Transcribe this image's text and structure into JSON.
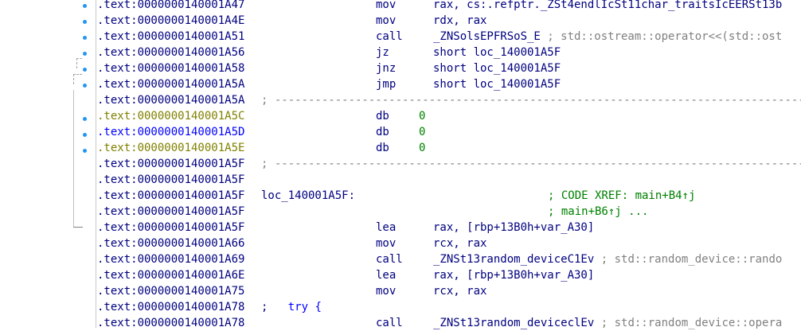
{
  "rows": [
    {
      "addr": ".text:0000000140001A47",
      "mnem": "mov",
      "ops": "rax, cs:.refptr._ZSt4endlIcSt11char_traitsIcEERSt13b",
      "comment": ""
    },
    {
      "addr": ".text:0000000140001A4E",
      "mnem": "mov",
      "ops": "rdx, rax",
      "comment": ""
    },
    {
      "addr": ".text:0000000140001A51",
      "mnem": "call",
      "ops": "_ZNSolsEPFRSoS_E",
      "comment": " ; std::ostream::operator<<(std::ost"
    },
    {
      "addr": ".text:0000000140001A56",
      "mnem": "jz",
      "ops": "short loc_140001A5F",
      "comment": ""
    },
    {
      "addr": ".text:0000000140001A58",
      "mnem": "jnz",
      "ops": "short loc_140001A5F",
      "comment": ""
    },
    {
      "addr": ".text:0000000140001A5A",
      "mnem": "jmp",
      "ops": "short loc_140001A5F",
      "comment": ""
    },
    {
      "addr": ".text:0000000140001A5A",
      "sep": "; ---------------------------------------------------------------------------------------"
    },
    {
      "addr": ".text:0000000140001A5C",
      "color": "yellow",
      "db": "db",
      "val": "0"
    },
    {
      "addr": ".text:0000000140001A5D",
      "color": "blue",
      "db": "db",
      "val": "0"
    },
    {
      "addr": ".text:0000000140001A5E",
      "color": "yellow",
      "db": "db",
      "val": "0"
    },
    {
      "addr": ".text:0000000140001A5F",
      "sep": "; ---------------------------------------------------------------------------------------"
    },
    {
      "addr": ".text:0000000140001A5F",
      "mnem": "",
      "ops": "",
      "comment": ""
    },
    {
      "addr": ".text:0000000140001A5F",
      "label": "loc_140001A5F:",
      "xref": "; CODE XREF: main+B4↑j"
    },
    {
      "addr": ".text:0000000140001A5F",
      "xref": "; main+B6↑j ..."
    },
    {
      "addr": ".text:0000000140001A5F",
      "mnem": "lea",
      "ops": "rax, [rbp+13B0h+var_A30]",
      "comment": ""
    },
    {
      "addr": ".text:0000000140001A66",
      "mnem": "mov",
      "ops": "rcx, rax",
      "comment": ""
    },
    {
      "addr": ".text:0000000140001A69",
      "mnem": "call",
      "ops": "_ZNSt13random_deviceC1Ev",
      "comment": " ; std::random_device::rando"
    },
    {
      "addr": ".text:0000000140001A6E",
      "mnem": "lea",
      "ops": "rax, [rbp+13B0h+var_A30]",
      "comment": ""
    },
    {
      "addr": ".text:0000000140001A75",
      "mnem": "mov",
      "ops": "rcx, rax",
      "comment": ""
    },
    {
      "addr": ".text:0000000140001A78",
      "try_semi": ";",
      "try_kw": "try {"
    },
    {
      "addr": ".text:0000000140001A78",
      "mnem": "call",
      "ops": "_ZNSt13random_deviceclEv",
      "comment": " ; std::random_device::opera"
    }
  ]
}
